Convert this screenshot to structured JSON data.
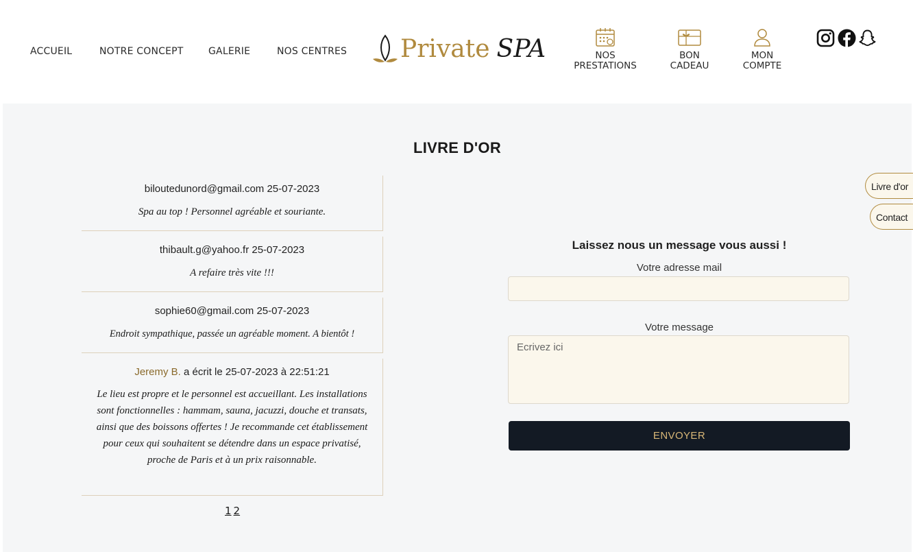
{
  "nav": {
    "accueil": "ACCUEIL",
    "concept": "NOTRE CONCEPT",
    "galerie": "GALERIE",
    "centres": "NOS CENTRES"
  },
  "logo": {
    "word1": "Private",
    "word2": "SPA"
  },
  "icon_nav": {
    "prestations_line1": "NOS",
    "prestations_line2": "PRESTATIONS",
    "cadeau_line1": "BON",
    "cadeau_line2": "CADEAU",
    "compte_line1": "MON",
    "compte_line2": "COMPTE"
  },
  "social_icons": [
    "instagram-icon",
    "facebook-icon",
    "snapchat-icon"
  ],
  "main": {
    "title": "LIVRE D'OR"
  },
  "reviews": [
    {
      "email": "biloutedunord@gmail.com",
      "date": "25-07-2023",
      "text": "Spa au top ! Personnel agréable et souriante."
    },
    {
      "email": "thibault.g@yahoo.fr",
      "date": "25-07-2023",
      "text": "A refaire très vite !!!"
    },
    {
      "email": "sophie60@gmail.com",
      "date": "25-07-2023",
      "text": "Endroit sympathique, passée un agréable moment. A bientôt !"
    },
    {
      "author": "Jeremy B.",
      "wrote": "a écrit le 25-07-2023 à 22:51:21",
      "text": "Le lieu est propre et le personnel est accueillant. Les installations sont fonctionnelles : hammam, sauna, jacuzzi, douche et transats, ainsi que des boissons offertes ! Je recommande cet établissement pour ceux qui souhaitent se détendre dans un espace privatisé, proche de Paris et à un prix raisonnable."
    }
  ],
  "pagination": {
    "page1": "1",
    "page2": "2"
  },
  "form": {
    "heading": "Laissez nous un message vous aussi !",
    "email_label": "Votre adresse mail",
    "email_value": "",
    "message_label": "Votre message",
    "message_placeholder": "Ecrivez ici",
    "submit": "ENVOYER"
  },
  "side_tabs": {
    "livre": "Livre d'or",
    "contact": "Contact"
  },
  "colors": {
    "gold": "#b08a3e",
    "dark_button": "#131a24",
    "input_bg": "#fbf7ec",
    "page_bg": "#f5f6f7"
  }
}
